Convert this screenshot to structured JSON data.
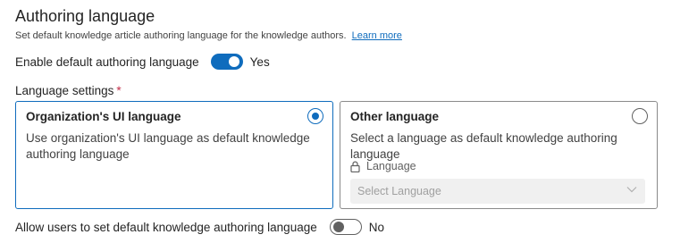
{
  "header": {
    "title": "Authoring language",
    "description": "Set default knowledge article authoring language for the knowledge authors.",
    "learn_more": "Learn more"
  },
  "enable_default": {
    "label": "Enable default authoring language",
    "state": "Yes",
    "on": true
  },
  "language_settings": {
    "label": "Language settings",
    "required_marker": "*",
    "options": [
      {
        "title": "Organization's UI language",
        "description_line1": "Use organization's UI language as default knowledge",
        "description_line2": "authoring language",
        "selected": true
      },
      {
        "title": "Other language",
        "description": "Select a language as default knowledge authoring language",
        "selected": false,
        "field_label": "Language",
        "select_placeholder": "Select Language"
      }
    ]
  },
  "allow_users": {
    "label": "Allow users to set default knowledge authoring language",
    "state": "No",
    "on": false
  },
  "colors": {
    "accent": "#0f6cbd",
    "required": "#c4314b"
  }
}
